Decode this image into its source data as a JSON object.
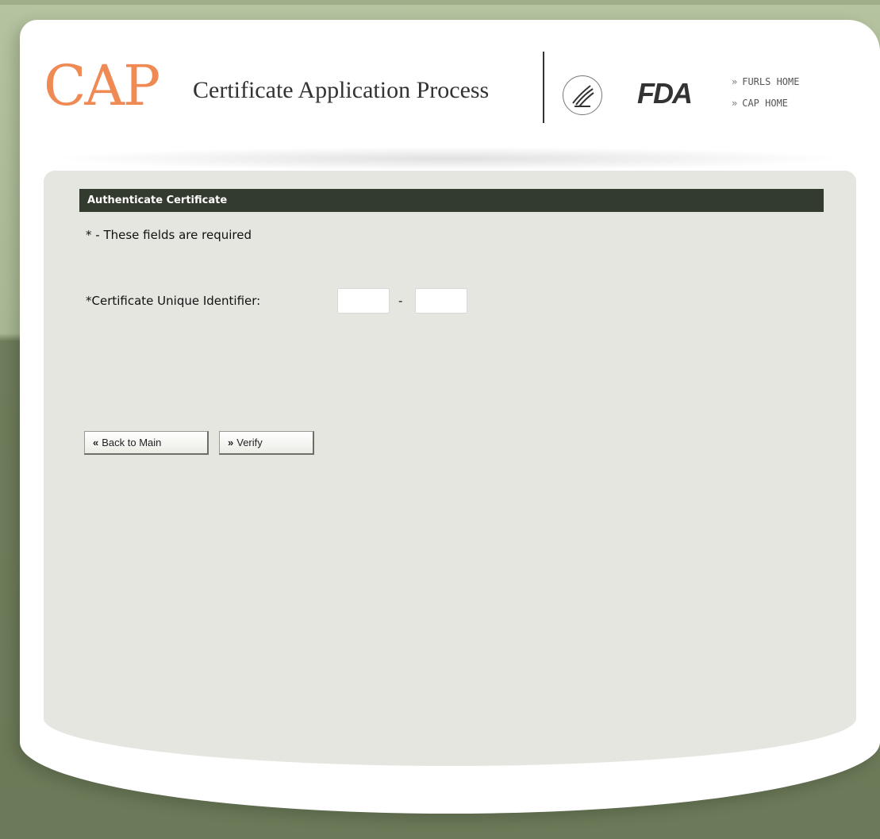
{
  "header": {
    "logo_text": "CAP",
    "logo_subtitle": "Certificate Application Process",
    "fda_logo": "FDA",
    "links": [
      {
        "label": "FURLS HOME",
        "prefix": "»"
      },
      {
        "label": "CAP HOME",
        "prefix": "»"
      }
    ]
  },
  "section": {
    "title": "Authenticate Certificate",
    "required_note": "* - These fields are required"
  },
  "form": {
    "cuid_label": "*Certificate Unique Identifier:",
    "separator": "-",
    "part1_value": "",
    "part2_value": ""
  },
  "buttons": {
    "back_label": "Back to Main",
    "back_icon": "double-chevron-left-icon",
    "verify_label": "Verify",
    "verify_icon": "double-chevron-right-icon"
  },
  "colors": {
    "logo_orange": "#f08a55",
    "section_bar": "#333a2e",
    "panel": "#e6e6e1",
    "outer_green": "#6b7a58"
  }
}
